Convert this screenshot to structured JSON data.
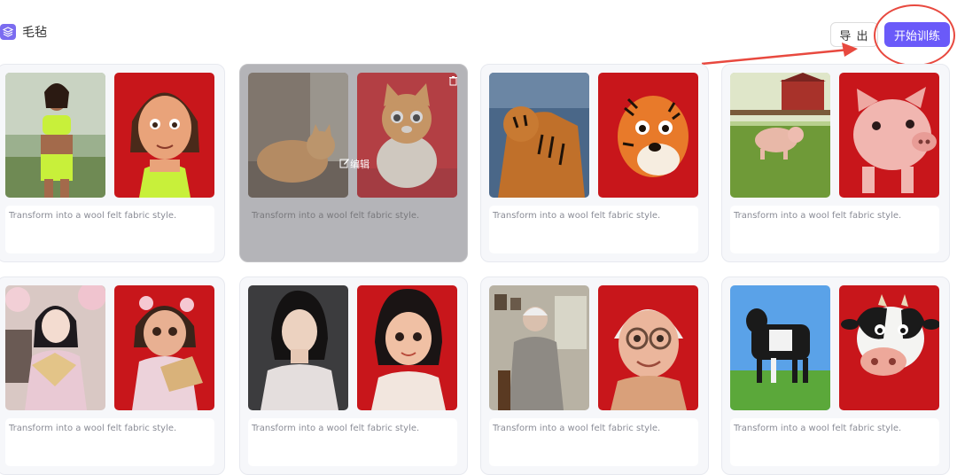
{
  "header": {
    "dataset_title": "毛毡",
    "export_label": "导 出",
    "train_label": "开始训练"
  },
  "cards": [
    {
      "caption": "Transform into a wool felt fabric style.",
      "subject": "woman athlete"
    },
    {
      "caption": "Transform into a wool felt fabric style.",
      "subject": "cat",
      "edit_label": "编辑"
    },
    {
      "caption": "Transform into a wool felt fabric style.",
      "subject": "tiger"
    },
    {
      "caption": "Transform into a wool felt fabric style.",
      "subject": "pig"
    },
    {
      "caption": "Transform into a wool felt fabric style.",
      "subject": "hanfu girl with fan"
    },
    {
      "caption": "Transform into a wool felt fabric style.",
      "subject": "woman portrait"
    },
    {
      "caption": "Transform into a wool felt fabric style.",
      "subject": "elderly woman"
    },
    {
      "caption": "Transform into a wool felt fabric style.",
      "subject": "cow"
    }
  ],
  "colors": {
    "accent": "#6a5af9",
    "felt_background_red": "#c8161b",
    "annotation_red": "#e8493f"
  },
  "icons": [
    "layers-icon",
    "edit-icon",
    "trash-icon",
    "arrow-annotation"
  ]
}
